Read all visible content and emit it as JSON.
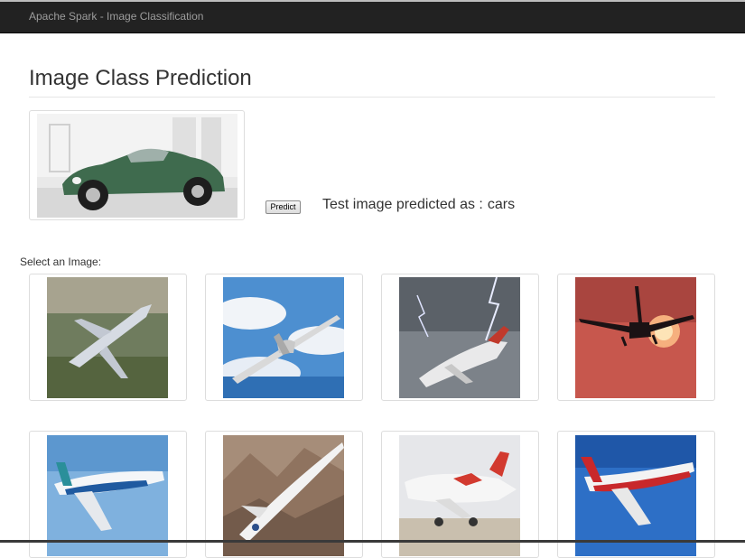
{
  "navbar": {
    "brand": "Apache Spark - Image Classification"
  },
  "page": {
    "title": "Image Class Prediction"
  },
  "test_image": {
    "subject": "vintage green sports car"
  },
  "predict_button": {
    "label": "Predict"
  },
  "result": {
    "prefix": "Test image predicted as :",
    "predicted_class": "cars"
  },
  "gallery": {
    "label": "Select an Image:",
    "images": [
      {
        "subject": "small business jet over forest"
      },
      {
        "subject": "propeller plane above clouds"
      },
      {
        "subject": "airliner in lightning storm"
      },
      {
        "subject": "airliner silhouette at sunset"
      },
      {
        "subject": "Boeing airliner blue sky"
      },
      {
        "subject": "supersonic jet over mountains"
      },
      {
        "subject": "red-tail jet on runway"
      },
      {
        "subject": "red and white Boeing jet"
      }
    ]
  },
  "colors": {
    "navbar": "#222222",
    "brand_text": "#9d9d9d",
    "text": "#333333"
  }
}
